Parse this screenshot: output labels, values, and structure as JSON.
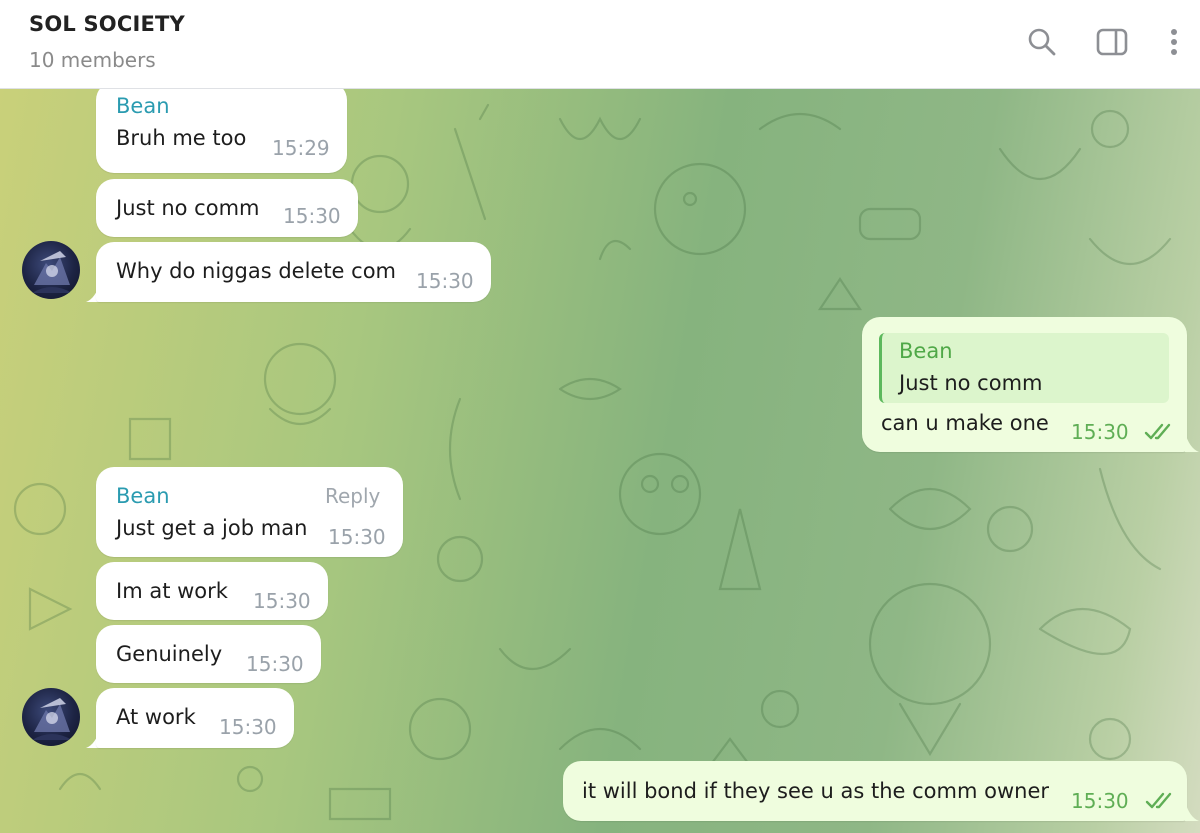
{
  "header": {
    "title": "SOL SOCIETY",
    "subtitle": "10 members",
    "icons": [
      "search-icon",
      "sidebar-toggle-icon",
      "more-vertical-icon"
    ]
  },
  "colors": {
    "incoming_bubble": "#ffffff",
    "outgoing_bubble": "#effdde",
    "sender_name": "#2a9bb0",
    "quote_name": "#4fa847",
    "outgoing_time": "#5fae55"
  },
  "messages": [
    {
      "sender": "Bean",
      "text": "Bruh me too",
      "time": "15:29"
    },
    {
      "text": "Just no comm",
      "time": "15:30"
    },
    {
      "text": "Why do niggas delete com",
      "time": "15:30"
    },
    {
      "quote_sender": "Bean",
      "quote_text": "Just no comm",
      "text": "can u make one",
      "time": "15:30",
      "status": "read"
    },
    {
      "sender": "Bean",
      "action": "Reply",
      "text": "Just get a job man",
      "time": "15:30"
    },
    {
      "text": "Im at work",
      "time": "15:30"
    },
    {
      "text": "Genuinely",
      "time": "15:30"
    },
    {
      "text": "At work",
      "time": "15:30"
    },
    {
      "text": "it will bond if they see u as the comm owner",
      "time": "15:30",
      "status": "read"
    }
  ]
}
